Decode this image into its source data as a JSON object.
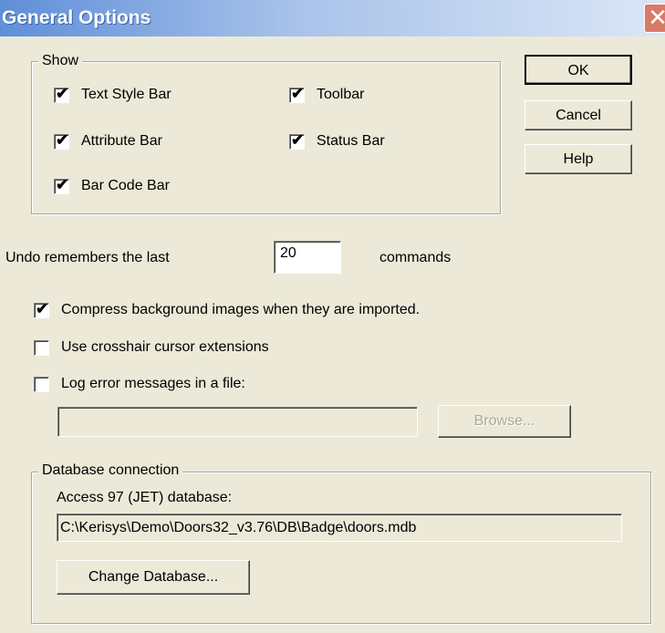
{
  "window": {
    "title": "General Options",
    "close_glyph": "✕"
  },
  "buttons": {
    "ok": "OK",
    "cancel": "Cancel",
    "help": "Help"
  },
  "show_group": {
    "legend": "Show",
    "items": [
      {
        "label": "Text Style Bar",
        "checked": true
      },
      {
        "label": "Toolbar",
        "checked": true
      },
      {
        "label": "Attribute Bar",
        "checked": true
      },
      {
        "label": "Status Bar",
        "checked": true
      },
      {
        "label": "Bar Code Bar",
        "checked": true
      }
    ]
  },
  "undo": {
    "prefix": "Undo remembers the last",
    "value": "20",
    "suffix": "commands"
  },
  "options": [
    {
      "label": "Compress background images when they are imported.",
      "checked": true
    },
    {
      "label": "Use crosshair cursor extensions",
      "checked": false
    },
    {
      "label": "Log error messages in a file:",
      "checked": false
    }
  ],
  "log_file": {
    "path": "",
    "browse_label": "Browse..."
  },
  "database": {
    "legend": "Database connection",
    "type_label": "Access 97 (JET) database:",
    "path": "C:\\Kerisys\\Demo\\Doors32_v3.76\\DB\\Badge\\doors.mdb",
    "change_label": "Change Database..."
  },
  "check_glyph": "✔",
  "colors": {
    "dialog_bg": "#ece9d8",
    "title_start": "#5f8fd9",
    "close_bg": "#d97a66",
    "disabled_text": "#aca899"
  }
}
